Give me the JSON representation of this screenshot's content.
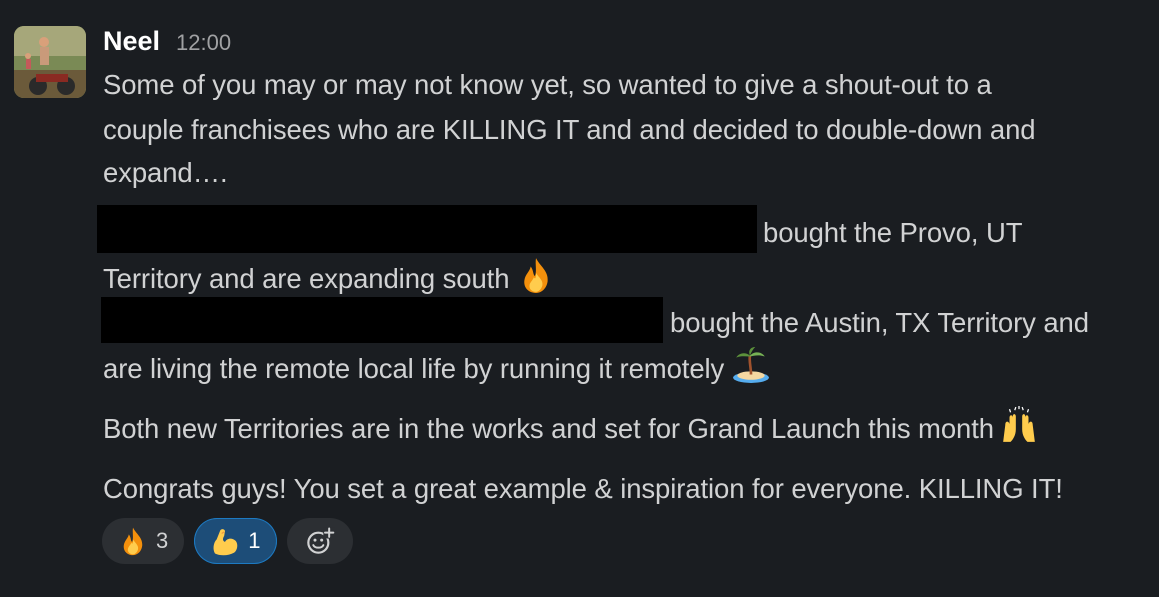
{
  "message": {
    "author": "Neel",
    "time": "12:00",
    "lines": {
      "l1": "Some of you may or may not know yet, so wanted to give a shout-out to a",
      "l2": "couple franchisees who are KILLING IT and and decided to double-down and",
      "l3": "expand….",
      "l4": "bought the Provo, UT",
      "l5": "Territory and are expanding south",
      "l6": "bought the Austin, TX Territory and",
      "l7": "are living the remote local life by running it remotely",
      "l8": "Both new Territories are in the works and set for Grand Launch this month",
      "l9": "Congrats guys! You set a great example & inspiration for everyone. KILLING IT!"
    },
    "inline_emoji": [
      "fire-icon",
      "desert-island-icon",
      "raised-hands-icon"
    ]
  },
  "reactions": [
    {
      "emoji": "fire-icon",
      "count": "3",
      "active": false
    },
    {
      "emoji": "flexed-biceps-icon",
      "count": "1",
      "active": true
    },
    {
      "emoji": "add-reaction-icon",
      "count": "",
      "active": false
    }
  ],
  "colors": {
    "background": "#1a1d21",
    "text": "#d1d2d3",
    "author": "#ffffff",
    "timestamp": "#a0a1a3",
    "reaction_bg": "#2c2f33",
    "reaction_active_bg": "#1d4d78",
    "reaction_active_border": "#1d7ac2"
  }
}
